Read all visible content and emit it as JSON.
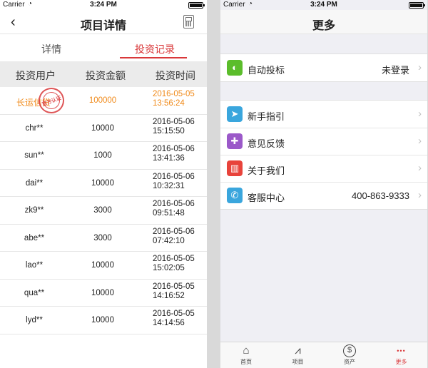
{
  "status": {
    "carrier": "Carrier",
    "time": "3:24 PM"
  },
  "left": {
    "title": "项目详情",
    "tabs": [
      "详情",
      "投资记录"
    ],
    "active_tab": 1,
    "columns": [
      "投资用户",
      "投资金额",
      "投资时间"
    ],
    "rows": [
      {
        "user": "长运信贷",
        "amount": "100000",
        "date": "2016-05-05",
        "time": "13:56:24"
      },
      {
        "user": "chr**",
        "amount": "10000",
        "date": "2016-05-06",
        "time": "15:15:50"
      },
      {
        "user": "sun**",
        "amount": "1000",
        "date": "2016-05-06",
        "time": "13:41:36"
      },
      {
        "user": "dai**",
        "amount": "10000",
        "date": "2016-05-06",
        "time": "10:32:31"
      },
      {
        "user": "zk9**",
        "amount": "3000",
        "date": "2016-05-06",
        "time": "09:51:48"
      },
      {
        "user": "abe**",
        "amount": "3000",
        "date": "2016-05-06",
        "time": "07:42:10"
      },
      {
        "user": "lao**",
        "amount": "10000",
        "date": "2016-05-05",
        "time": "15:02:05"
      },
      {
        "user": "qua**",
        "amount": "10000",
        "date": "2016-05-05",
        "time": "14:16:52"
      },
      {
        "user": "lyd**",
        "amount": "10000",
        "date": "2016-05-05",
        "time": "14:14:56"
      }
    ],
    "stamp_text": "官方认证"
  },
  "right": {
    "title": "更多",
    "group1": [
      {
        "label": "自动投标",
        "value": "未登录",
        "icon": "auto-bid-icon",
        "color": "#5bbd2b"
      }
    ],
    "group2": [
      {
        "label": "新手指引",
        "value": "",
        "icon": "navigation-arrow-icon",
        "color": "#3aa6dd"
      },
      {
        "label": "意见反馈",
        "value": "",
        "icon": "puzzle-icon",
        "color": "#9b59c9"
      },
      {
        "label": "关于我们",
        "value": "",
        "icon": "gift-icon",
        "color": "#e8433b"
      },
      {
        "label": "客服中心",
        "value": "400-863-9333",
        "icon": "phone-icon",
        "color": "#3aa6dd"
      }
    ],
    "tabbar": [
      {
        "label": "首页",
        "icon": "home-icon"
      },
      {
        "label": "项目",
        "icon": "chart-icon"
      },
      {
        "label": "资产",
        "icon": "dollar-icon"
      },
      {
        "label": "更多",
        "icon": "more-dots-icon"
      }
    ],
    "active_tab": 3
  }
}
